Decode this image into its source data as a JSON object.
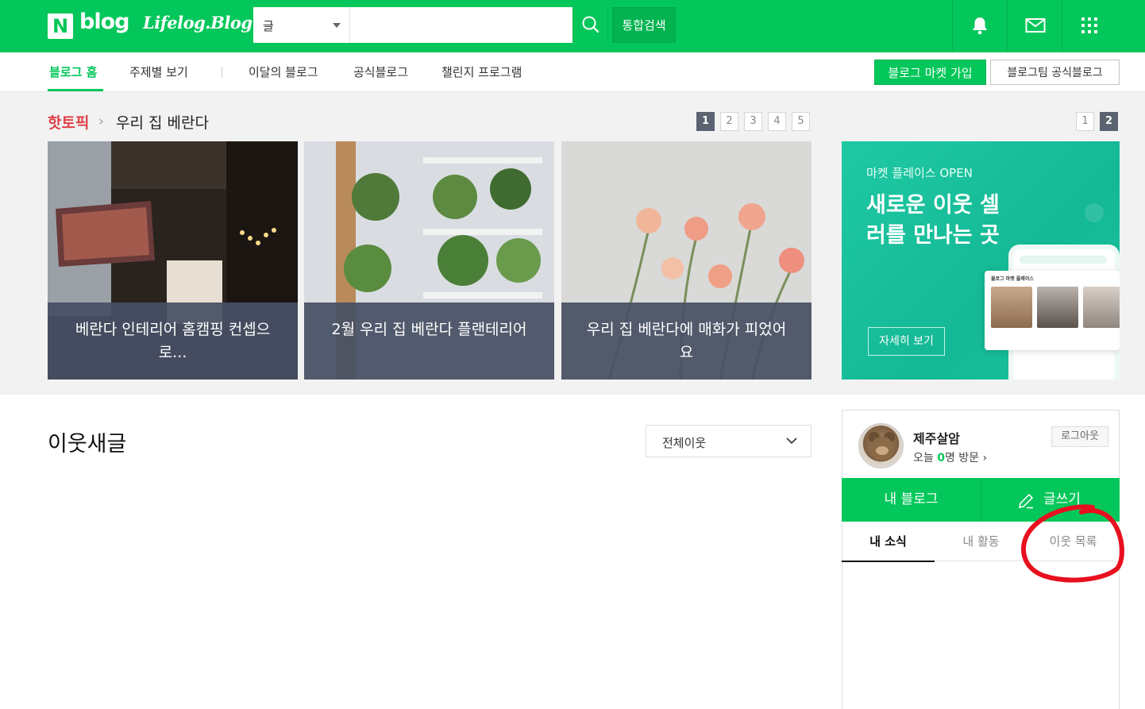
{
  "header": {
    "logo_n": "N",
    "logo_blog": "blog",
    "logo_lifelog": "Lifelog.Blog",
    "search_select_label": "글",
    "search_placeholder": "",
    "total_search_label": "통합검색"
  },
  "nav": {
    "items": [
      "블로그 홈",
      "주제별 보기",
      "이달의 블로그",
      "공식블로그",
      "챌린지 프로그램"
    ],
    "market_button": "블로그 마켓 가입",
    "official_button": "블로그팀 공식블로그"
  },
  "hot_topic": {
    "label": "핫토픽",
    "title": "우리 집 베란다",
    "pages": [
      "1",
      "2",
      "3",
      "4",
      "5"
    ],
    "current_page": "1",
    "ad_pages": [
      "1",
      "2"
    ],
    "ad_current_page": "2",
    "cards": [
      {
        "caption": "베란다 인테리어 홈캠핑 컨셉으로..."
      },
      {
        "caption": "2월 우리 집 베란다 플랜테리어"
      },
      {
        "caption": "우리 집 베란다에 매화가 피었어요"
      }
    ]
  },
  "ad": {
    "subtitle": "마켓 플레이스 OPEN",
    "headline": "새로운 이웃 셀러를 만나는 곳",
    "button": "자세히 보기",
    "card_title": "블로그 마켓 플레이스"
  },
  "neighbor": {
    "title": "이웃새글",
    "filter_label": "전체이웃"
  },
  "profile": {
    "name": "제주살암",
    "visit_prefix": "오늘 ",
    "visit_count": "0",
    "visit_suffix": "명 방문 ›",
    "logout": "로그아웃",
    "my_blog": "내 블로그",
    "write": "글쓰기",
    "tabs": [
      "내 소식",
      "내 활동",
      "이웃 목록"
    ],
    "active_tab": "내 소식"
  },
  "colors": {
    "brand_green": "#03c75a",
    "hot_red": "#e0424a",
    "annotation_red": "#e8101e"
  }
}
